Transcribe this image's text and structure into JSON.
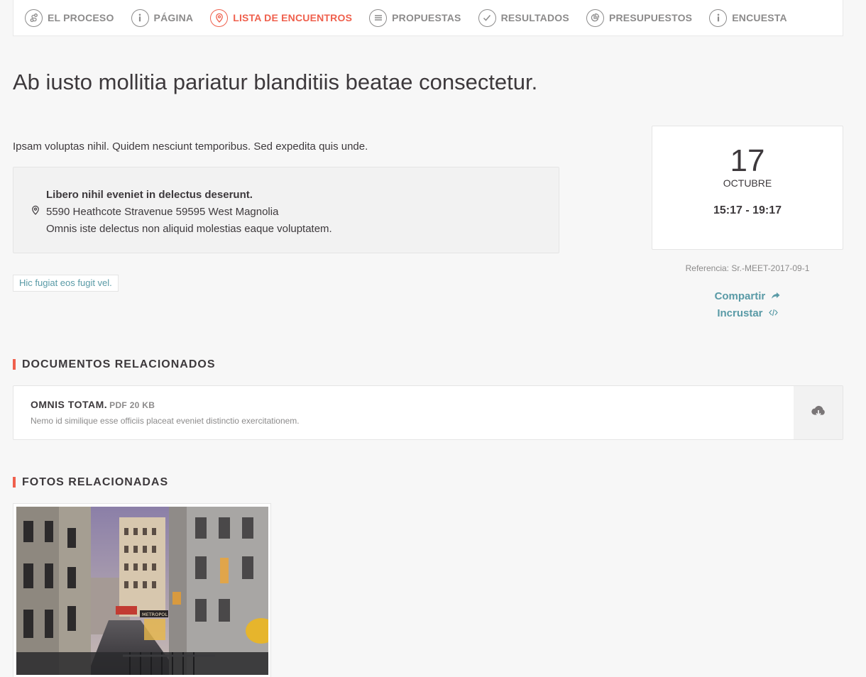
{
  "nav": {
    "items": [
      {
        "label": "EL PROCESO",
        "icon": "process-icon",
        "active": false
      },
      {
        "label": "PÁGINA",
        "icon": "info-icon",
        "active": false
      },
      {
        "label": "LISTA DE ENCUENTROS",
        "icon": "map-pin-icon",
        "active": true
      },
      {
        "label": "PROPUESTAS",
        "icon": "list-lines-icon",
        "active": false
      },
      {
        "label": "RESULTADOS",
        "icon": "check-icon",
        "active": false
      },
      {
        "label": "PRESUPUESTOS",
        "icon": "pie-chart-icon",
        "active": false
      },
      {
        "label": "ENCUESTA",
        "icon": "info-icon",
        "active": false
      }
    ]
  },
  "meeting": {
    "title": "Ab iusto mollitia pariatur blanditiis beatae consectetur.",
    "summary": "Ipsam voluptas nihil. Quidem nesciunt temporibus. Sed expedita quis unde.",
    "address": {
      "location": "Libero nihil eveniet in delectus deserunt.",
      "street": "5590 Heathcote Stravenue 59595 West Magnolia",
      "hints": "Omnis iste delectus non aliquid molestias eaque voluptatem."
    },
    "tag": "Hic fugiat eos fugit vel.",
    "date": {
      "day": "17",
      "month": "OCTUBRE",
      "time": "15:17 - 19:17"
    },
    "reference": "Referencia: Sr.-MEET-2017-09-1",
    "share_label": "Compartir",
    "embed_label": "Incrustar"
  },
  "documents": {
    "title": "DOCUMENTOS RELACIONADOS",
    "items": [
      {
        "name": "OMNIS TOTAM.",
        "meta": "PDF 20 KB",
        "description": "Nemo id similique esse officiis placeat eveniet distinctio exercitationem.",
        "icon": "cloud-download-icon"
      }
    ]
  },
  "photos": {
    "title": "FOTOS RELACIONADAS",
    "items": [
      {
        "alt": "",
        "sign_text": "METROPOL"
      }
    ]
  },
  "colors": {
    "accent": "#ef604d",
    "link": "#599aa6",
    "text": "#3d393c",
    "muted": "#8c8b8b",
    "background": "#f7f7f7"
  }
}
